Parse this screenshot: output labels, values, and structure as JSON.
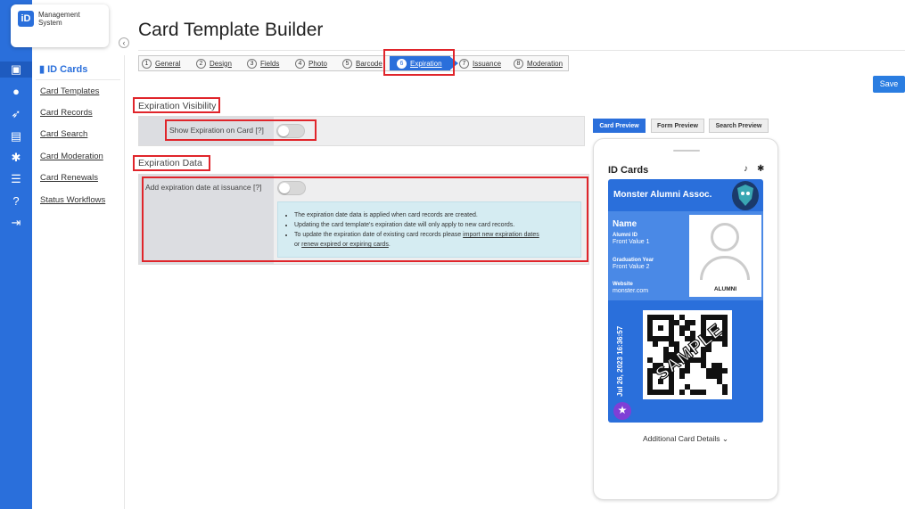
{
  "app": {
    "logo_badge": "iD",
    "logo_line1": "Management",
    "logo_line2": "System",
    "collapse_glyph": "‹"
  },
  "rail": {
    "icons": [
      "id-card-icon",
      "chat-icon",
      "rocket-icon",
      "document-icon",
      "gear-icon",
      "list-icon",
      "help-icon",
      "signout-icon"
    ]
  },
  "subnav": {
    "heading": "ID Cards",
    "items": [
      "Card Templates",
      "Card Records",
      "Card Search",
      "Card Moderation",
      "Card Renewals",
      "Status Workflows"
    ]
  },
  "page": {
    "title": "Card Template Builder",
    "save_label": "Save"
  },
  "steps": [
    {
      "num": "1",
      "label": "General"
    },
    {
      "num": "2",
      "label": "Design"
    },
    {
      "num": "3",
      "label": "Fields"
    },
    {
      "num": "4",
      "label": "Photo"
    },
    {
      "num": "5",
      "label": "Barcode"
    },
    {
      "num": "6",
      "label": "Expiration",
      "active": true
    },
    {
      "num": "7",
      "label": "Issuance"
    },
    {
      "num": "8",
      "label": "Moderation"
    }
  ],
  "visibility": {
    "section": "Expiration Visibility",
    "label": "Show Expiration on Card [?]",
    "enabled": false
  },
  "data": {
    "section": "Expiration Data",
    "label": "Add expiration date at issuance [?]",
    "enabled": false,
    "info1": "The expiration date data is applied when card records are created.",
    "info2": "Updating the card template's expiration date will only apply to new card records.",
    "info3_pre": "To update the expiration date of existing card records please ",
    "info3_link1": "import new expiration dates",
    "info3_or": "or ",
    "info3_link2": "renew expired or expiring cards",
    "info3_end": "."
  },
  "preview": {
    "tabs": [
      "Card Preview",
      "Form Preview",
      "Search Preview"
    ],
    "active_tab": 0,
    "app_title": "ID Cards",
    "icons": [
      "bell-icon",
      "gear-icon"
    ],
    "org": "Monster Alumni Assoc.",
    "name_label": "Name",
    "fields": [
      {
        "label": "Alumni ID",
        "value": "Front Value 1"
      },
      {
        "label": "Graduation Year",
        "value": "Front Value 2"
      },
      {
        "label": "Website",
        "value": "monster.com"
      }
    ],
    "photo_caption": "ALUMNI",
    "datetime": "Jul 26, 2023   16:36:57",
    "watermark": "SAMPLE",
    "badge_icon": "star-icon",
    "details_label": "Additional Card Details ⌄"
  },
  "colors": {
    "accent": "#2a6fdb",
    "highlight": "#e0252b",
    "info_bg": "#d5ecf2"
  }
}
